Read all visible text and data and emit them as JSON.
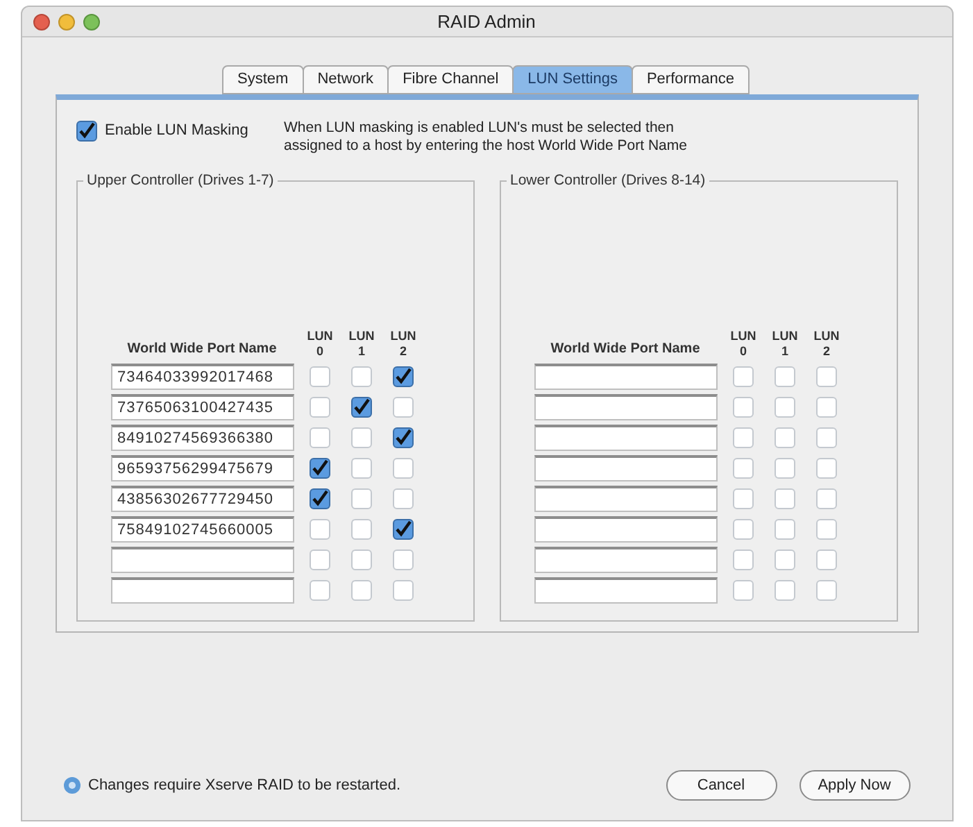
{
  "window": {
    "title": "RAID Admin"
  },
  "tabs": [
    {
      "label": "System",
      "selected": false
    },
    {
      "label": "Network",
      "selected": false
    },
    {
      "label": "Fibre Channel",
      "selected": false
    },
    {
      "label": "LUN Settings",
      "selected": true
    },
    {
      "label": "Performance",
      "selected": false
    }
  ],
  "masking": {
    "label": "Enable LUN Masking",
    "checked": true,
    "description": "When LUN masking is enabled LUN's must be selected then assigned to a host by entering the host World Wide Port Name"
  },
  "controllers": [
    {
      "title": "Upper Controller (Drives 1-7)",
      "name_header": "World Wide Port Name",
      "lun_headers": [
        [
          "LUN",
          "0"
        ],
        [
          "LUN",
          "1"
        ],
        [
          "LUN",
          "2"
        ]
      ],
      "rows": [
        {
          "value": "73464033992017468",
          "luns": [
            false,
            false,
            true
          ]
        },
        {
          "value": "73765063100427435",
          "luns": [
            false,
            true,
            false
          ]
        },
        {
          "value": "84910274569366380",
          "luns": [
            false,
            false,
            true
          ]
        },
        {
          "value": "96593756299475679",
          "luns": [
            true,
            false,
            false
          ]
        },
        {
          "value": "43856302677729450",
          "luns": [
            true,
            false,
            false
          ]
        },
        {
          "value": "75849102745660005",
          "luns": [
            false,
            false,
            true
          ]
        },
        {
          "luns": [
            false,
            false,
            false
          ]
        },
        {
          "luns": [
            false,
            false,
            false
          ]
        }
      ]
    },
    {
      "title": "Lower Controller (Drives 8-14)",
      "name_header": "World Wide Port Name",
      "lun_headers": [
        [
          "LUN",
          "0"
        ],
        [
          "LUN",
          "1"
        ],
        [
          "LUN",
          "2"
        ]
      ],
      "rows": [
        {
          "luns": [
            false,
            false,
            false
          ]
        },
        {
          "luns": [
            false,
            false,
            false
          ]
        },
        {
          "luns": [
            false,
            false,
            false
          ]
        },
        {
          "luns": [
            false,
            false,
            false
          ]
        },
        {
          "luns": [
            false,
            false,
            false
          ]
        },
        {
          "luns": [
            false,
            false,
            false
          ]
        },
        {
          "luns": [
            false,
            false,
            false
          ]
        },
        {
          "luns": [
            false,
            false,
            false
          ]
        }
      ]
    }
  ],
  "status": {
    "text": "Changes require Xserve RAID to be restarted."
  },
  "buttons": [
    {
      "label": "Cancel"
    },
    {
      "label": "Apply Now"
    }
  ]
}
